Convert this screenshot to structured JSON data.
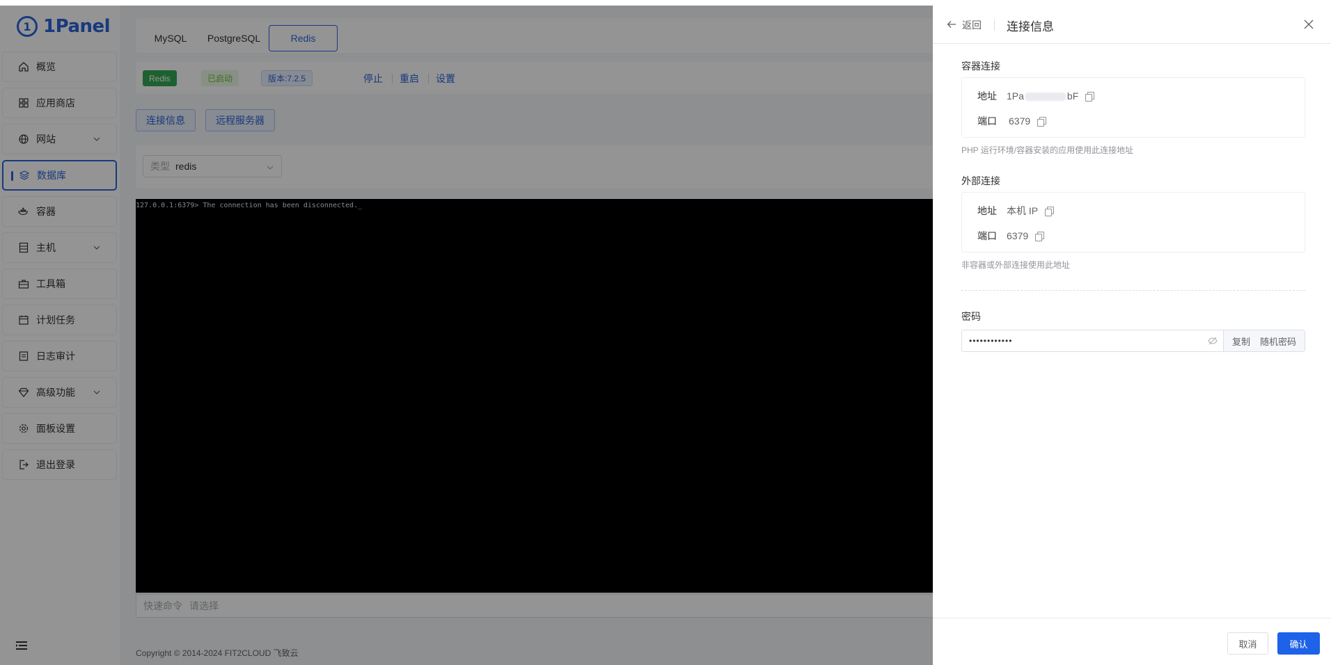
{
  "app": {
    "logo_text": "1Panel"
  },
  "sidebar": {
    "items": [
      {
        "label": "概览",
        "icon": "home-icon"
      },
      {
        "label": "应用商店",
        "icon": "grid-icon"
      },
      {
        "label": "网站",
        "icon": "globe-icon",
        "has_children": true
      },
      {
        "label": "数据库",
        "icon": "layers-icon",
        "active": true
      },
      {
        "label": "容器",
        "icon": "docker-icon"
      },
      {
        "label": "主机",
        "icon": "server-icon",
        "has_children": true
      },
      {
        "label": "工具箱",
        "icon": "toolbox-icon"
      },
      {
        "label": "计划任务",
        "icon": "calendar-icon"
      },
      {
        "label": "日志审计",
        "icon": "log-icon"
      },
      {
        "label": "高级功能",
        "icon": "diamond-icon",
        "has_children": true
      },
      {
        "label": "面板设置",
        "icon": "gear-icon"
      },
      {
        "label": "退出登录",
        "icon": "logout-icon"
      }
    ]
  },
  "db_tabs": [
    "MySQL",
    "PostgreSQL",
    "Redis"
  ],
  "active_tab": "Redis",
  "status": {
    "app_tag": "Redis",
    "state_tag": "已启动",
    "version_tag": "版本:7.2.5",
    "actions": [
      "停止",
      "重启",
      "设置"
    ]
  },
  "buttons": {
    "conn_info": "连接信息",
    "remote_server": "远程服务器"
  },
  "filter": {
    "label": "类型",
    "value": "redis"
  },
  "terminal": {
    "text": "127.0.0.1:6379> The connection has been disconnected._"
  },
  "quick_cmd": {
    "label": "快速命令",
    "placeholder": "请选择"
  },
  "footer": {
    "copyright": "Copyright © 2014-2024 FIT2CLOUD 飞致云"
  },
  "drawer": {
    "back_label": "返回",
    "title": "连接信息",
    "container": {
      "title": "容器连接",
      "addr_key": "地址",
      "addr_value_start": "1Pa",
      "addr_value_end": "bF",
      "port_key": "端口",
      "port_value": "6379",
      "hint": "PHP 运行环境/容器安装的应用使用此连接地址"
    },
    "external": {
      "title": "外部连接",
      "addr_key": "地址",
      "addr_value": "本机 IP",
      "port_key": "端口",
      "port_value": "6379",
      "hint": "非容器或外部连接使用此地址"
    },
    "password": {
      "label": "密码",
      "masked_value": "••••••••••••",
      "copy_btn": "复制",
      "random_btn": "随机密码"
    },
    "cancel": "取消",
    "confirm": "确认"
  },
  "colors": {
    "primary": "#2b63d9",
    "success": "#34a853",
    "confirm": "#1d62e8"
  }
}
